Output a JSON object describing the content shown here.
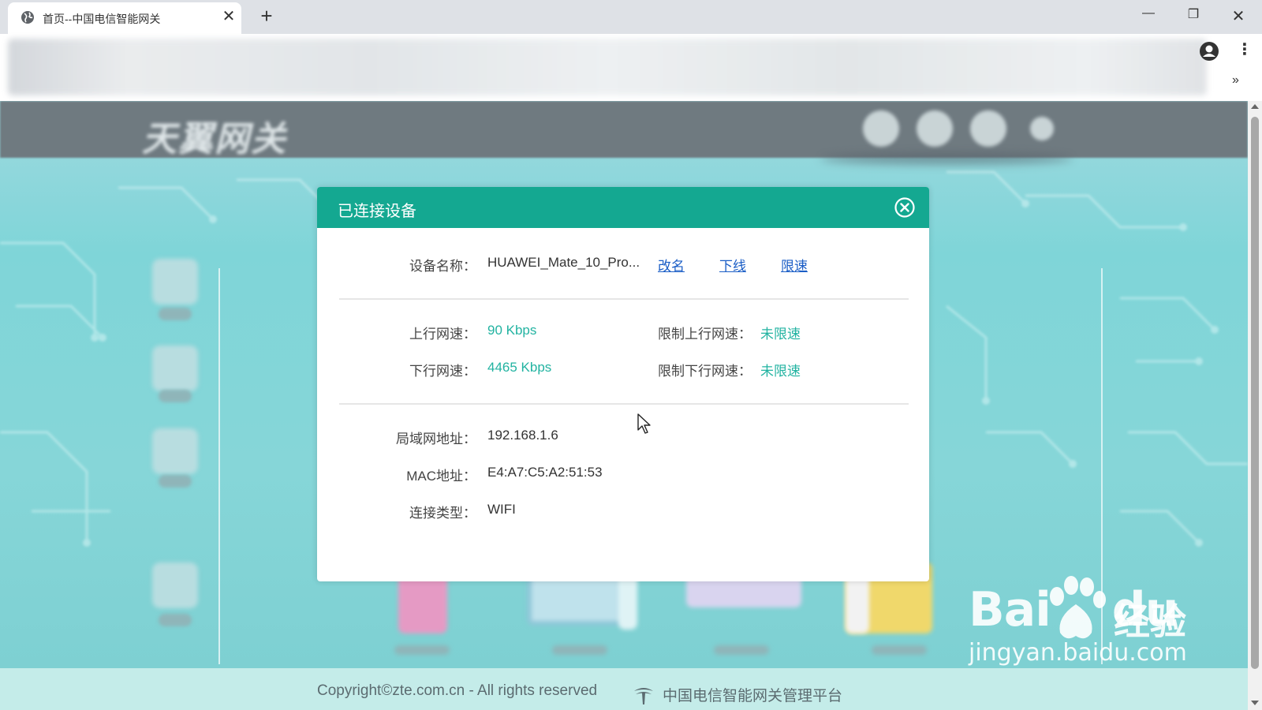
{
  "browser": {
    "tab_title": "首页--中国电信智能网关",
    "tab_close": "✕",
    "new_tab": "+",
    "win_min": "—",
    "win_max": "❐",
    "win_close": "✕",
    "more": "»",
    "kebab": "⋮"
  },
  "site": {
    "logo_text": "天翼网关"
  },
  "modal": {
    "title": "已连接设备",
    "device_name_label": "设备名称：",
    "device_name": "HUAWEI_Mate_10_Pro...",
    "actions": {
      "rename": "改名",
      "offline": "下线",
      "limit": "限速"
    },
    "upload_label": "上行网速：",
    "upload_value": "90 Kbps",
    "download_label": "下行网速：",
    "download_value": "4465 Kbps",
    "limit_up_label": "限制上行网速：",
    "limit_up_value": "未限速",
    "limit_down_label": "限制下行网速：",
    "limit_down_value": "未限速",
    "lan_label": "局域网地址：",
    "lan_value": "192.168.1.6",
    "mac_label": "MAC地址：",
    "mac_value": "E4:A7:C5:A2:51:53",
    "conn_label": "连接类型：",
    "conn_value": "WIFI"
  },
  "footer": {
    "copyright": "Copyright©zte.com.cn - All rights reserved",
    "platform": "中国电信智能网关管理平台"
  },
  "watermark": {
    "baidu": "Bai",
    "du": "du",
    "jingyan": "经验",
    "url": "jingyan.baidu.com"
  },
  "colors": {
    "modal_header": "#14a891",
    "accent_green": "#22b3a1",
    "link_blue": "#1b5ec6"
  }
}
